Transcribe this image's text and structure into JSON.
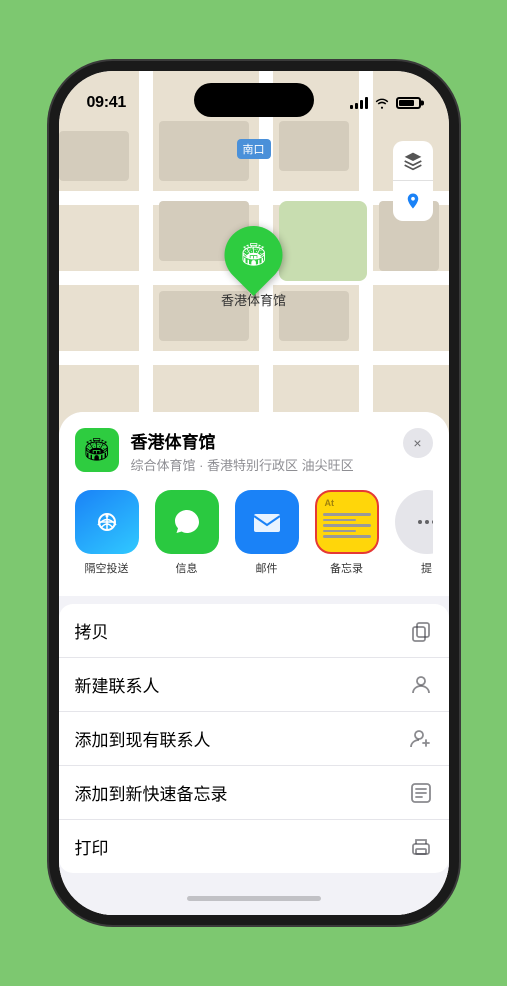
{
  "status_bar": {
    "time": "09:41",
    "location_arrow": "▶"
  },
  "map": {
    "label": "南口",
    "pin_label": "香港体育馆",
    "pin_emoji": "🏟"
  },
  "venue": {
    "name": "香港体育馆",
    "subtitle": "综合体育馆 · 香港特别行政区 油尖旺区",
    "icon_emoji": "🏟",
    "close_label": "×"
  },
  "share_items": [
    {
      "id": "airdrop",
      "label": "隔空投送",
      "type": "airdrop"
    },
    {
      "id": "messages",
      "label": "信息",
      "type": "messages"
    },
    {
      "id": "mail",
      "label": "邮件",
      "type": "mail"
    },
    {
      "id": "notes",
      "label": "备忘录",
      "type": "notes"
    },
    {
      "id": "more",
      "label": "提",
      "type": "more"
    }
  ],
  "actions": [
    {
      "id": "copy",
      "label": "拷贝",
      "icon": "copy"
    },
    {
      "id": "new-contact",
      "label": "新建联系人",
      "icon": "person"
    },
    {
      "id": "add-contact",
      "label": "添加到现有联系人",
      "icon": "person-add"
    },
    {
      "id": "quick-note",
      "label": "添加到新快速备忘录",
      "icon": "note"
    },
    {
      "id": "print",
      "label": "打印",
      "icon": "print"
    }
  ]
}
